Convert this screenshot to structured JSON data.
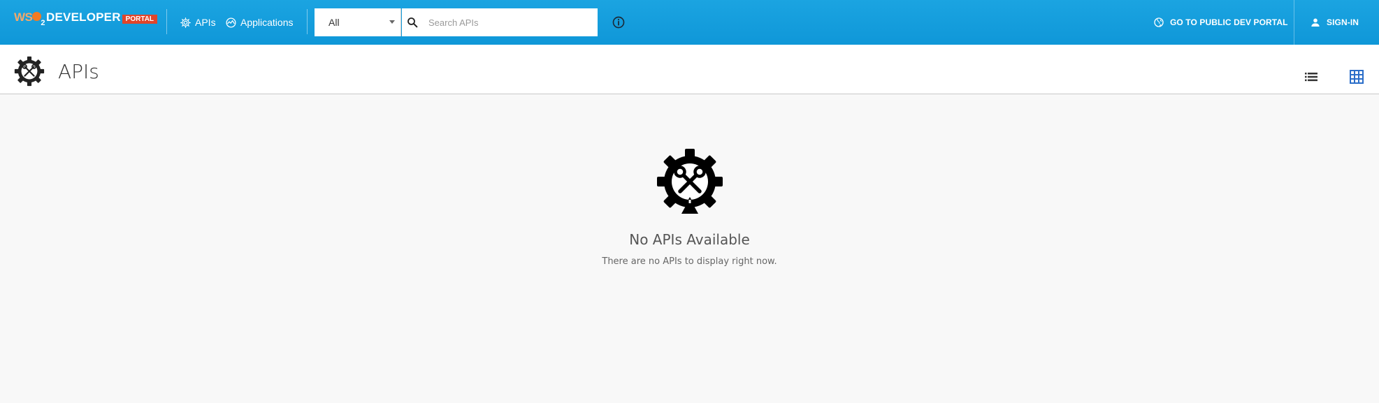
{
  "header": {
    "logo": {
      "wso2": "WSO2",
      "sub": "2",
      "developer": "DEVELOPER",
      "portal": "PORTAL"
    },
    "nav": [
      {
        "label": "APIs",
        "icon": "gear-icon"
      },
      {
        "label": "Applications",
        "icon": "applications-icon"
      }
    ],
    "search": {
      "filter_value": "All",
      "placeholder": "Search APIs"
    },
    "public_portal_label": "GO TO PUBLIC DEV PORTAL",
    "signin_label": "SIGN-IN"
  },
  "page": {
    "title": "APIs",
    "views": [
      "list-view",
      "grid-view"
    ],
    "active_view": "grid-view"
  },
  "empty_state": {
    "title": "No APIs Available",
    "message": "There are no APIs to display right now."
  },
  "colors": {
    "appbar": "#1ba4e1",
    "portal_badge": "#e0452a",
    "active_view": "#2b6ec9"
  }
}
